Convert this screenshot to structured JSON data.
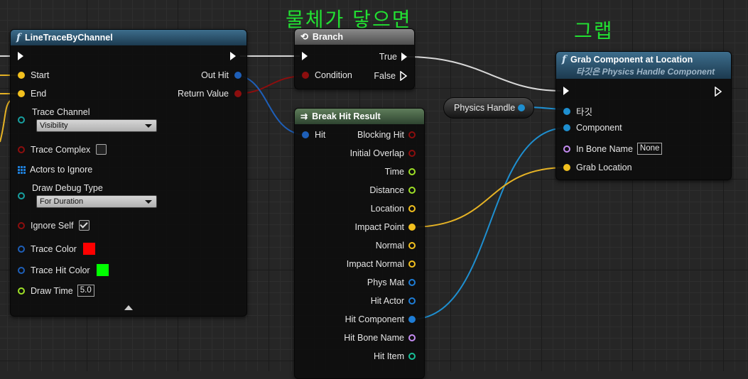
{
  "annotations": {
    "top": "물체가 닿으면",
    "right": "그랩"
  },
  "colors": {
    "exec": "#ffffff",
    "bool": "#8c0e0e",
    "vector": "#f2c01e",
    "object": "#1e7dd6",
    "float": "#9ee026",
    "name": "#c58cf2",
    "struct": "#1aa0c0",
    "wire_object": "#1e8fd0",
    "wire_vector": "#e6b325"
  },
  "trace": {
    "title": "LineTraceByChannel",
    "inputs": {
      "start": "Start",
      "end": "End",
      "trace_channel": "Trace Channel",
      "trace_channel_value": "Visibility",
      "trace_complex": "Trace Complex",
      "actors_to_ignore": "Actors to Ignore",
      "draw_debug_type": "Draw Debug Type",
      "draw_debug_value": "For Duration",
      "ignore_self": "Ignore Self",
      "trace_color": "Trace Color",
      "trace_hit_color": "Trace Hit Color",
      "draw_time": "Draw Time",
      "draw_time_value": "5.0"
    },
    "outputs": {
      "out_hit": "Out Hit",
      "return_value": "Return Value"
    },
    "swatch_colors": {
      "trace": "#ff0000",
      "hit": "#00ff00"
    }
  },
  "branch": {
    "title": "Branch",
    "condition": "Condition",
    "true_label": "True",
    "false_label": "False"
  },
  "breakhit": {
    "title": "Break Hit Result",
    "input": "Hit",
    "outputs": [
      "Blocking Hit",
      "Initial Overlap",
      "Time",
      "Distance",
      "Location",
      "Impact Point",
      "Normal",
      "Impact Normal",
      "Phys Mat",
      "Hit Actor",
      "Hit Component",
      "Hit Bone Name",
      "Hit Item"
    ]
  },
  "physics_handle": {
    "label": "Physics Handle"
  },
  "grab": {
    "title": "Grab Component at Location",
    "subtitle": "타깃은 Physics Handle Component",
    "inputs": {
      "target": "타깃",
      "component": "Component",
      "bone_name": "In Bone Name",
      "bone_value": "None",
      "grab_location": "Grab Location"
    }
  }
}
